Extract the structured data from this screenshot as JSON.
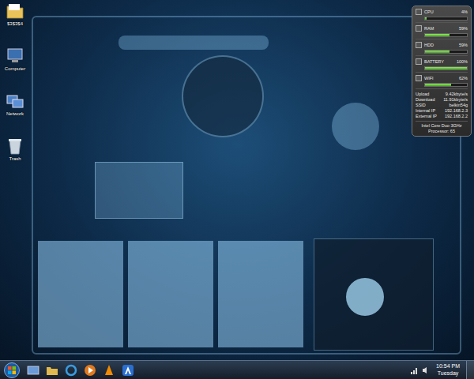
{
  "desktop_icons": [
    {
      "label": "$3$3$4"
    },
    {
      "label": "Computer"
    },
    {
      "label": "Network"
    },
    {
      "label": "Trash"
    }
  ],
  "gadget": {
    "meters": [
      {
        "name": "CPU",
        "reading": "4%",
        "level": 0.04
      },
      {
        "name": "RAM",
        "reading": "59%",
        "level": 0.59
      },
      {
        "name": "HDD",
        "reading": "59%",
        "level": 0.59
      },
      {
        "name": "BATTERY",
        "reading": "100%",
        "level": 1
      },
      {
        "name": "WIFI",
        "reading": "62%",
        "level": 0.62
      }
    ],
    "network": [
      {
        "label": "Upload",
        "value": "9.42kbyte/s"
      },
      {
        "label": "Download",
        "value": "11.91kbyte/s"
      },
      {
        "label": "SSID",
        "value": "belkin54g"
      },
      {
        "label": "Internal IP",
        "value": "192.168.2.3"
      },
      {
        "label": "External IP",
        "value": "192.168.2.2"
      }
    ],
    "footer": [
      "Intel Core Duo 3GHz",
      "Processor: 65"
    ]
  },
  "taskbar": {
    "clock": {
      "time": "10:54 PM",
      "day": "Tuesday"
    }
  }
}
